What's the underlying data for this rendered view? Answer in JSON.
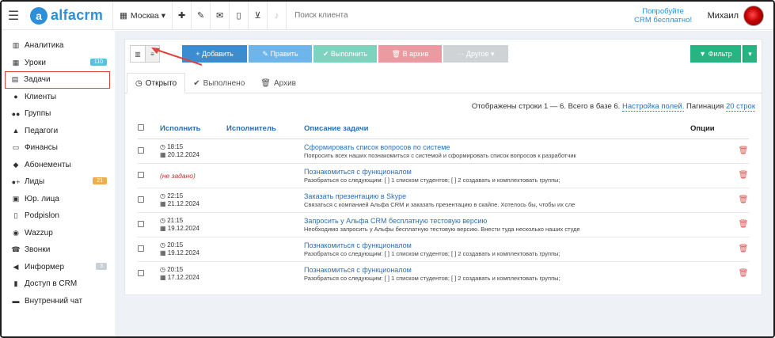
{
  "app": {
    "name": "alfacrm",
    "logo_letter": "a"
  },
  "topbar": {
    "city": "Москва",
    "city_caret": "▾",
    "search_placeholder": "Поиск клиента",
    "promo_line1": "Попробуйте",
    "promo_line2": "CRM бесплатно!",
    "user_name": "Михаил",
    "icons": [
      "plus-icon",
      "wrench-icon",
      "mail-icon",
      "phone-icon",
      "cart-icon",
      "bell-icon"
    ]
  },
  "sidebar": {
    "items": [
      {
        "label": "Аналитика",
        "icon": "map-icon",
        "glyph": "▥"
      },
      {
        "label": "Уроки",
        "icon": "calendar-icon",
        "glyph": "▦",
        "badge": "110",
        "badge_color": "#5bc0de"
      },
      {
        "label": "Задачи",
        "icon": "clipboard-icon",
        "glyph": "▤",
        "active": true
      },
      {
        "label": "Клиенты",
        "icon": "user-icon",
        "glyph": "●"
      },
      {
        "label": "Группы",
        "icon": "users-icon",
        "glyph": "●●"
      },
      {
        "label": "Педагоги",
        "icon": "graduation-cap-icon",
        "glyph": "▲"
      },
      {
        "label": "Финансы",
        "icon": "money-icon",
        "glyph": "▭"
      },
      {
        "label": "Абонементы",
        "icon": "tag-icon",
        "glyph": "◆"
      },
      {
        "label": "Лиды",
        "icon": "user-plus-icon",
        "glyph": "●+",
        "badge": "21",
        "badge_color": "#f0ad4e"
      },
      {
        "label": "Юр. лица",
        "icon": "briefcase-icon",
        "glyph": "▣"
      },
      {
        "label": "Podpislon",
        "icon": "document-icon",
        "glyph": "▯"
      },
      {
        "label": "Wazzup",
        "icon": "whatsapp-icon",
        "glyph": "◉"
      },
      {
        "label": "Звонки",
        "icon": "phone-icon",
        "glyph": "☎"
      },
      {
        "label": "Информер",
        "icon": "bullhorn-icon",
        "glyph": "◀",
        "badge": "3",
        "badge_color": "#c9cfd6"
      },
      {
        "label": "Доступ в CRM",
        "icon": "lock-icon",
        "glyph": "▮"
      },
      {
        "label": "Внутренний чат",
        "icon": "chat-icon",
        "glyph": "▬"
      }
    ]
  },
  "toolbar": {
    "view_icons": [
      "columns-icon",
      "list-icon"
    ],
    "buttons": [
      {
        "label": "+ Добавить",
        "color": "#3c8dcf",
        "w": 82
      },
      {
        "label": "✎ Править",
        "color": "#6db5ea",
        "w": 80
      },
      {
        "label": "✔ Выполнить",
        "color": "#7dd3bd",
        "w": 80
      },
      {
        "label": "🗑 В архив",
        "color": "#ea9aa0",
        "w": 80
      },
      {
        "label": "··· Другое ▾",
        "color": "#d0d3d6",
        "w": 82
      }
    ],
    "filter_label": "▼ Фильтр",
    "filter_color": "#26b483",
    "filter_caret": "▾"
  },
  "tabs": [
    {
      "label": "Открыто",
      "icon": "clock-icon",
      "glyph": "◷",
      "active": true
    },
    {
      "label": "Выполнено",
      "icon": "check-icon",
      "glyph": "✔"
    },
    {
      "label": "Архив",
      "icon": "trash-icon",
      "glyph": "🗑"
    }
  ],
  "info": {
    "rows_text": "Отображены строки 1 — 6. Всего в базе 6.",
    "settings_link": "Настройка полей.",
    "pagination_label": "Пагинация",
    "pagination_value": "20 строк"
  },
  "table": {
    "headers": {
      "do": "Исполнить",
      "executor": "Исполнитель",
      "desc": "Описание задачи",
      "opts": "Опции"
    },
    "rows": [
      {
        "time": "18:15",
        "date": "20.12.2024",
        "title": "Сформировать список вопросов по системе",
        "desc": "Попросить всех наших познакомиться с системой и сформировать список вопросов к разработчик"
      },
      {
        "unset": "(не задано)",
        "title": "Познакомиться с функционалом",
        "desc": "Разобраться со следующим: [ ] 1 списком студентов; [ ] 2 создавать и комплектовать группы;"
      },
      {
        "time": "22:15",
        "date": "21.12.2024",
        "title": "Заказать презентацию в Skype",
        "desc": "Связаться с компанией Альфа CRM и заказать презентацию в скайпе. Хотелось бы, чтобы их сле"
      },
      {
        "time": "21:15",
        "date": "19.12.2024",
        "title": "Запросить у Альфа CRM бесплатную тестовую версию",
        "desc": "Необходимо запросить у Альфы бесплатную тестовую версию. Внести туда несколько наших студе"
      },
      {
        "time": "20:15",
        "date": "19.12.2024",
        "title": "Познакомиться с функционалом",
        "desc": "Разобраться со следующим: [ ] 1 списком студентов; [ ] 2 создавать и комплектовать группы;"
      },
      {
        "time": "20:15",
        "date": "17.12.2024",
        "title": "Познакомиться с функционалом",
        "desc": "Разобраться со следующим: [ ] 1 списком студентов; [ ] 2 создавать и комплектовать группы;"
      }
    ]
  },
  "colors": {
    "accent": "#2d8fd8",
    "link": "#2d6fb5",
    "annotation_red": "#e04141",
    "trash": "#d9534f"
  }
}
